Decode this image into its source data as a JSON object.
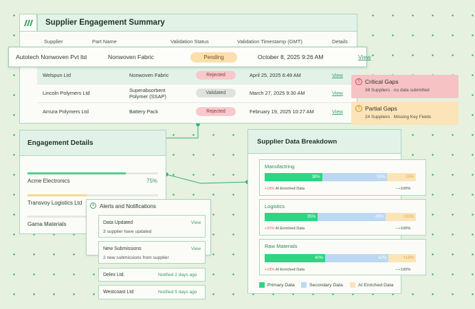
{
  "summary": {
    "title": "Supplier Engagement Summary",
    "columns": [
      "Supplier",
      "Part Name",
      "Validation Status",
      "Validation Timestamp (GMT)",
      "Details"
    ],
    "highlight": {
      "supplier": "Autotech Nonwoven Pvt ltd",
      "part": "Nonwoven Fabric",
      "status": "Pending",
      "timestamp": "October 8, 2025 9:26 AM",
      "details": "View"
    },
    "rows": [
      {
        "supplier": "Welspun Ltd",
        "part": "Nonwoven Fabric",
        "status": "Rejected",
        "timestamp": "April 25, 2025 6:49 AM",
        "details": "View"
      },
      {
        "supplier": "Lincoln Polymers Ltd",
        "part": "Superabsorbent Polymer (SSAP)",
        "part_line1": "Superabsorbent",
        "part_line2": "Polymer (SSAP)",
        "status": "Validated",
        "timestamp": "March 27, 2025 9:30 AM",
        "details": "View"
      },
      {
        "supplier": "Amura Polymers Ltd",
        "part": "Battery Pack",
        "status": "Rejected",
        "timestamp": "February 19, 2025 10:27 AM",
        "details": "View"
      }
    ]
  },
  "gaps": {
    "critical": {
      "title": "Critical Gaps",
      "count": "38 Suppliers",
      "desc": "no data submitted"
    },
    "partial": {
      "title": "Partial Gaps",
      "count": "24 Suppliers",
      "desc": "Missing Key Fields"
    }
  },
  "engagement": {
    "title": "Engagement Details",
    "items": [
      {
        "name": "Acme Electronics",
        "value": "75%",
        "progress": 0.75
      },
      {
        "name": "Transvoy Logistics Ltd",
        "progress": 0.45
      },
      {
        "name": "Gama Materials"
      }
    ]
  },
  "alerts": {
    "title": "Alerts and Notifications",
    "items": [
      {
        "title": "Data Updated",
        "sub": "3 supplier have updated",
        "link": "View"
      },
      {
        "title": "New Submissions",
        "sub": "2 new submissions from supplier",
        "link": "View"
      }
    ],
    "notices": [
      {
        "name": "Delex Ltd.",
        "time": "Notified 2 days ago"
      },
      {
        "name": "Westcoast Ltd",
        "time": "Notified 5 days ago"
      }
    ]
  },
  "breakdown": {
    "title": "Supplier Data Breakdown",
    "segments": [
      {
        "name": "Manufactring",
        "primary": "38%",
        "secondary": "53%",
        "ai": "15%",
        "enrich_pct": "+18%",
        "enrich_label": "AI Enriched Data",
        "total": "100%",
        "p_frac": 0.38,
        "s_frac": 0.43
      },
      {
        "name": "Logistics",
        "primary": "35%",
        "secondary": "45%",
        "ai": "+20%",
        "enrich_pct": "+20%",
        "enrich_label": "AI Enriched Data",
        "total": "100%",
        "p_frac": 0.35,
        "s_frac": 0.45
      },
      {
        "name": "Raw Materials",
        "primary": "40%",
        "secondary": "42%",
        "ai": "+18%",
        "enrich_pct": "+18%",
        "enrich_label": "AI Enriched Data",
        "total": "100%",
        "p_frac": 0.4,
        "s_frac": 0.42
      }
    ],
    "legend": [
      "Primary Data",
      "Secondary Data",
      "AI Enriched Data"
    ]
  },
  "colors": {
    "primary": "#2ed583",
    "secondary": "#bcd8f3",
    "ai": "#fbe4b7",
    "accent": "#3b9a6b",
    "critical": "#f7c2c4",
    "partial": "#fbe4b7"
  }
}
